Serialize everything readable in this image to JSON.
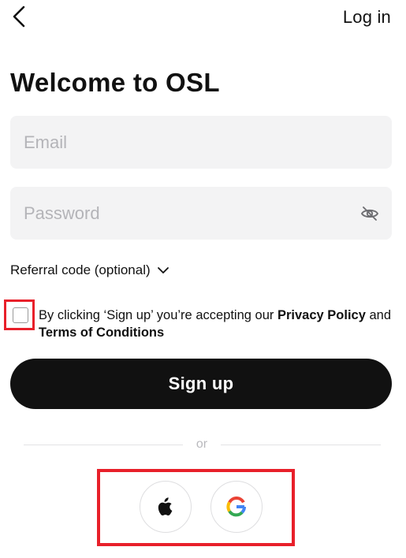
{
  "header": {
    "back_icon": "chevron-left-icon",
    "login_label": "Log in"
  },
  "title": "Welcome to OSL",
  "form": {
    "email_placeholder": "Email",
    "email_value": "",
    "password_placeholder": "Password",
    "password_value": "",
    "password_visibility_icon": "eye-off-icon",
    "referral_label": "Referral code (optional)",
    "referral_icon": "chevron-down-icon"
  },
  "terms": {
    "checked": false,
    "prefix": "By clicking ‘Sign up’ you’re accepting our ",
    "privacy_link": "Privacy Policy",
    "and": " and",
    "terms_link": "Terms of Conditions"
  },
  "signup_label": "Sign up",
  "divider_label": "or",
  "social": {
    "apple_icon": "apple-icon",
    "google_icon": "google-icon"
  },
  "colors": {
    "primary_button": "#111111",
    "input_background": "#f3f3f4",
    "highlight_outline": "#e8202a",
    "placeholder": "#b4b4b8"
  }
}
